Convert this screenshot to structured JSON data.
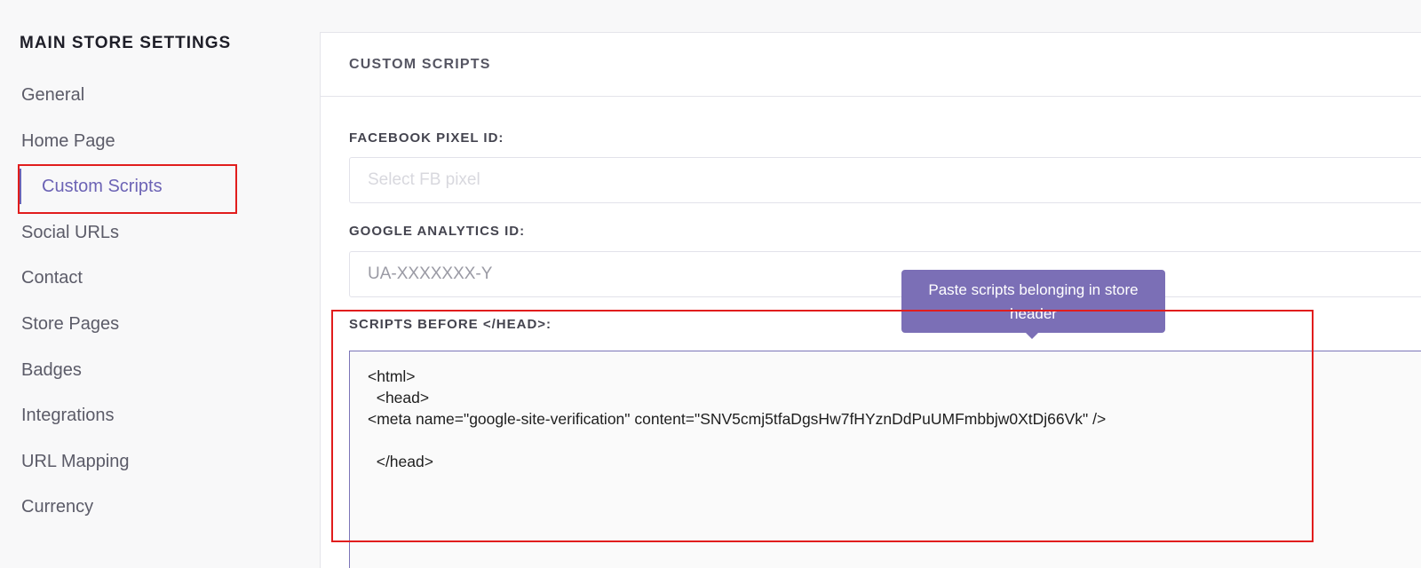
{
  "sidebar": {
    "title": "MAIN STORE SETTINGS",
    "items": [
      {
        "label": "General"
      },
      {
        "label": "Home Page"
      },
      {
        "label": "Custom Scripts"
      },
      {
        "label": "Social URLs"
      },
      {
        "label": "Contact"
      },
      {
        "label": "Store Pages"
      },
      {
        "label": "Badges"
      },
      {
        "label": "Integrations"
      },
      {
        "label": "URL Mapping"
      },
      {
        "label": "Currency"
      }
    ],
    "active_item": "Custom Scripts"
  },
  "panel": {
    "title": "CUSTOM SCRIPTS",
    "facebook": {
      "label": "FACEBOOK PIXEL ID:",
      "placeholder": "Select FB pixel",
      "value": ""
    },
    "google": {
      "label": "GOOGLE ANALYTICS ID:",
      "placeholder": "UA-XXXXXXX-Y",
      "value": ""
    },
    "scripts_head": {
      "label": "SCRIPTS BEFORE </HEAD>:",
      "value": "<html>\n  <head>\n<meta name=\"google-site-verification\" content=\"SNV5cmj5tfaDgsHw7fHYznDdPuUMFmbbjw0XtDj66Vk\" />\n\n  </head>",
      "tooltip": "Paste scripts belonging in store header"
    }
  },
  "colors": {
    "accent": "#6c63b5",
    "tooltip_bg": "#7b6fb6",
    "highlight": "#e11d1d"
  }
}
